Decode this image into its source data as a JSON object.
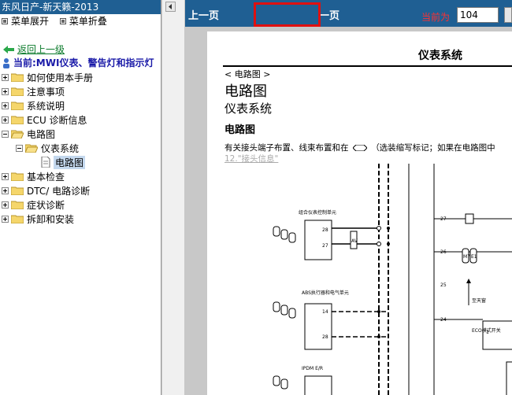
{
  "window": {
    "title": "东风日产-新天籁-2013"
  },
  "tree_actions": {
    "expand": "菜单展开",
    "collapse": "菜单折叠"
  },
  "back": {
    "label": "返回上一级"
  },
  "current": {
    "label": "当前:MWI仪表、警告灯和指示灯"
  },
  "tree": {
    "items": [
      {
        "label": "如何使用本手册"
      },
      {
        "label": "注意事项"
      },
      {
        "label": "系统说明"
      },
      {
        "label": "ECU 诊断信息"
      },
      {
        "label": "电路图"
      },
      {
        "label": "仪表系统"
      },
      {
        "label": "电路图"
      },
      {
        "label": "基本检查"
      },
      {
        "label": "DTC/ 电路诊断"
      },
      {
        "label": "症状诊断"
      },
      {
        "label": "拆卸和安装"
      }
    ]
  },
  "nav": {
    "prev": "上一页",
    "next": "下一页",
    "page_label": "当前为",
    "page_value": "104"
  },
  "document": {
    "header": "仪表系统",
    "section_tag": "< 电路图 >",
    "title1": "电路图",
    "title2": "仪表系统",
    "title3": "电路图",
    "desc_prefix": "有关接头端子布置、线束布置和在",
    "desc_suffix": "（选装缩写标记；如果在电路图中",
    "desc_link": "12.\"接头信息\""
  },
  "diagram": {
    "left_box1_label": "组合仪表控制单元",
    "left_box1_pins": [
      "28",
      "27"
    ],
    "left_box2_label": "ABS执行器和电气单元",
    "left_box2_pins": [
      "14",
      "28"
    ],
    "left_box3_label": "IPDM E/R",
    "connector_badge": "AV",
    "right_pins": [
      "27",
      "26",
      "25",
      "24"
    ],
    "right_badge1": "M7",
    "right_badge2": "E1",
    "ground_label": "至天窗",
    "ecu_label": "ECO模式开关",
    "ecu_pin": "1"
  },
  "colors": {
    "nav_bg": "#1f5f93",
    "highlight_border": "#e01010",
    "back_link": "#0a7a2a",
    "current_label": "#1a1aa8"
  }
}
